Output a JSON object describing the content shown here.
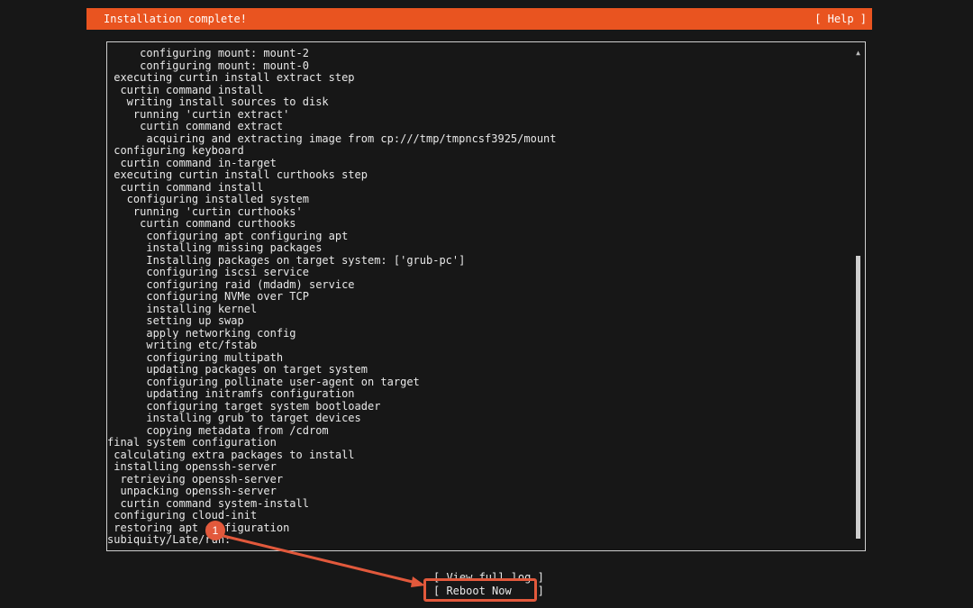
{
  "header": {
    "title": "Installation complete!",
    "help_label": "[ Help ]"
  },
  "log": {
    "lines": [
      "     configuring mount: mount-2",
      "     configuring mount: mount-0",
      " executing curtin install extract step",
      "  curtin command install",
      "   writing install sources to disk",
      "    running 'curtin extract'",
      "     curtin command extract",
      "      acquiring and extracting image from cp:///tmp/tmpncsf3925/mount",
      " configuring keyboard",
      "  curtin command in-target",
      " executing curtin install curthooks step",
      "  curtin command install",
      "   configuring installed system",
      "    running 'curtin curthooks'",
      "     curtin command curthooks",
      "      configuring apt configuring apt",
      "      installing missing packages",
      "      Installing packages on target system: ['grub-pc']",
      "      configuring iscsi service",
      "      configuring raid (mdadm) service",
      "      configuring NVMe over TCP",
      "      installing kernel",
      "      setting up swap",
      "      apply networking config",
      "      writing etc/fstab",
      "      configuring multipath",
      "      updating packages on target system",
      "      configuring pollinate user-agent on target",
      "      updating initramfs configuration",
      "      configuring target system bootloader",
      "      installing grub to target devices",
      "      copying metadata from /cdrom",
      "final system configuration",
      " calculating extra packages to install",
      " installing openssh-server",
      "  retrieving openssh-server",
      "  unpacking openssh-server",
      "  curtin command system-install",
      " configuring cloud-init",
      " restoring apt configuration",
      "subiquity/Late/run:"
    ]
  },
  "scrollbar": {
    "up_glyph": "▲"
  },
  "buttons": {
    "view_log_label": "[ View full log ]",
    "reboot_label": "[ Reboot Now    ]"
  },
  "annotation": {
    "badge_number": "1",
    "color": "#e2593c"
  },
  "colors": {
    "accent": "#e95420",
    "background": "#171717"
  }
}
